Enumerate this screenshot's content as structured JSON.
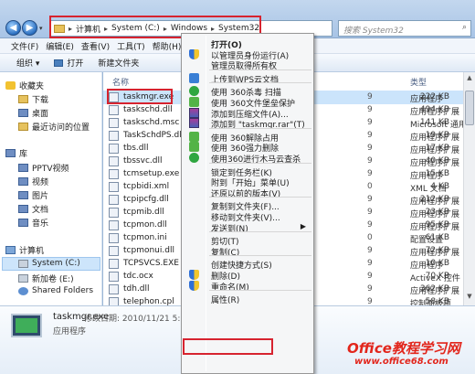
{
  "address": {
    "segments": [
      "计算机",
      "System (C:)",
      "Windows",
      "System32"
    ],
    "search_placeholder": "搜索 System32"
  },
  "menubar": [
    "文件(F)",
    "编辑(E)",
    "查看(V)",
    "工具(T)",
    "帮助(H)"
  ],
  "toolbar": {
    "organize": "组织 ▾",
    "open": "打开",
    "new_folder": "新建文件夹"
  },
  "navpane": {
    "favorites": "收藏夹",
    "downloads": "下载",
    "desktop": "桌面",
    "recent": "最近访问的位置",
    "libraries": "库",
    "pptv": "PPTV视频",
    "videos": "视频",
    "pictures": "图片",
    "documents": "文档",
    "music": "音乐",
    "computer": "计算机",
    "drive_c": "System (C:)",
    "drive_e": "新加卷 (E:)",
    "shared": "Shared Folders"
  },
  "filelist": {
    "col_name": "名称",
    "col_type": "类型",
    "rows": [
      {
        "name": "taskmgr.exe",
        "date": "9",
        "type": "应用程序",
        "size": "222 KB"
      },
      {
        "name": "taskschd.dll",
        "date": "9",
        "type": "应用程序扩展",
        "size": "494 KB"
      },
      {
        "name": "taskschd.msc",
        "date": "9",
        "type": "Microsoft 通用管理...",
        "size": "141 KB"
      },
      {
        "name": "TaskSchdPS.dll",
        "date": "9",
        "type": "应用程序扩展",
        "size": "19 KB"
      },
      {
        "name": "tbs.dll",
        "date": "9",
        "type": "应用程序扩展",
        "size": "17 KB"
      },
      {
        "name": "tbssvc.dll",
        "date": "9",
        "type": "应用程序扩展",
        "size": "40 KB"
      },
      {
        "name": "tcmsetup.exe",
        "date": "9",
        "type": "应用程序",
        "size": "15 KB"
      },
      {
        "name": "tcpbidi.xml",
        "date": "0",
        "type": "XML 文档",
        "size": "4 KB"
      },
      {
        "name": "tcpipcfg.dll",
        "date": "9",
        "type": "应用程序扩展",
        "size": "212 KB"
      },
      {
        "name": "tcpmib.dll",
        "date": "9",
        "type": "应用程序扩展",
        "size": "23 KB"
      },
      {
        "name": "tcpmon.dll",
        "date": "9",
        "type": "应用程序扩展",
        "size": "95 KB"
      },
      {
        "name": "tcpmon.ini",
        "date": "0",
        "type": "配置设置",
        "size": "61 KB"
      },
      {
        "name": "tcpmonui.dll",
        "date": "9",
        "type": "应用程序扩展",
        "size": "72 KB"
      },
      {
        "name": "TCPSVCS.EXE",
        "date": "9",
        "type": "应用程序",
        "size": "10 KB"
      },
      {
        "name": "tdc.ocx",
        "date": "9",
        "type": "ActiveX 控件",
        "size": "70 KB"
      },
      {
        "name": "tdh.dll",
        "date": "9",
        "type": "应用程序扩展",
        "size": "362 KB"
      },
      {
        "name": "telephon.cpl",
        "date": "9",
        "type": "控制面板项",
        "size": "58 KB"
      }
    ]
  },
  "details": {
    "name": "taskmgr.exe",
    "modified": "修改日期: 2010/11/21 5:2",
    "type": "应用程序"
  },
  "context_menu": {
    "open": "打开(O)",
    "run_as_admin": "以管理员身份运行(A)",
    "take_ownership": "管理员取得所有权",
    "upload_wps": "上传到WPS云文档",
    "scan_360": "使用 360杀毒 扫描",
    "protect_360": "使用 360文件堡垒保护",
    "add_archive": "添加到压缩文件(A)...",
    "add_rar": "添加到 \"taskmgr.rar\"(T)",
    "unlock_360": "使用 360解除占用",
    "force_delete_360": "使用 360强力删除",
    "trojan_scan_360": "使用360进行木马云查杀",
    "pin_taskbar": "锁定到任务栏(K)",
    "pin_start": "附到「开始」菜单(U)",
    "restore_versions": "还原以前的版本(V)",
    "copy_to": "复制到文件夹(F)...",
    "move_to": "移动到文件夹(V)...",
    "send_to": "发送到(N)",
    "cut": "剪切(T)",
    "copy": "复制(C)",
    "create_shortcut": "创建快捷方式(S)",
    "delete": "删除(D)",
    "rename": "重命名(M)",
    "properties": "属性(R)"
  },
  "watermark": {
    "brand": "Office教程学习网",
    "url": "www.office68.com"
  },
  "colors": {
    "highlight_red": "#d7232f",
    "selection_blue": "#cbe4fb"
  }
}
